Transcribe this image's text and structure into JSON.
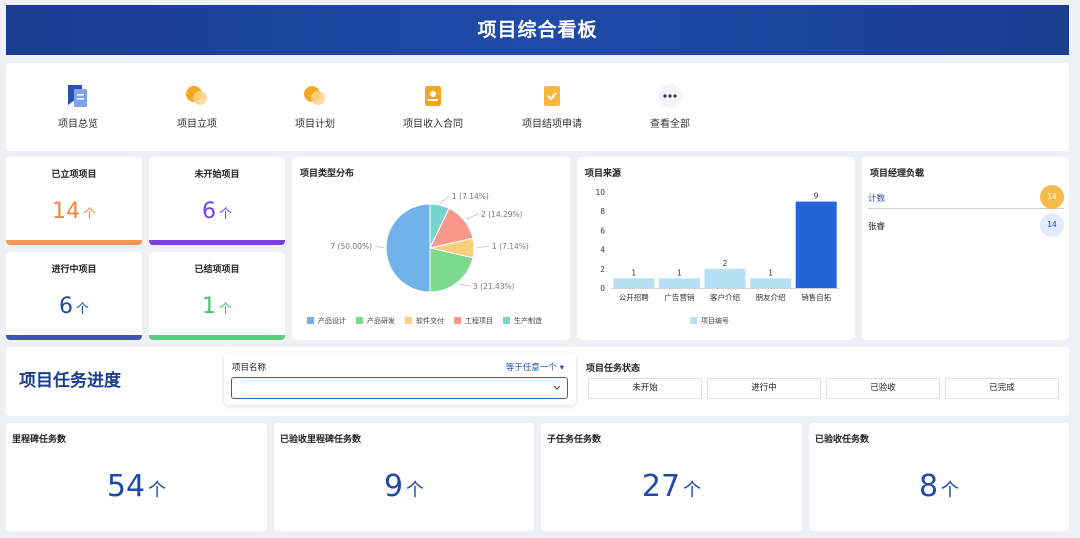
{
  "header": {
    "title": "项目综合看板"
  },
  "nav": {
    "items": [
      {
        "label": "项目总览",
        "icon": "bookmark-icon"
      },
      {
        "label": "项目立项",
        "icon": "circles-icon"
      },
      {
        "label": "项目计划",
        "icon": "circles-icon"
      },
      {
        "label": "项目收入合同",
        "icon": "contract-icon"
      },
      {
        "label": "项目结项申请",
        "icon": "check-document-icon"
      },
      {
        "label": "查看全部",
        "icon": "more-icon"
      }
    ]
  },
  "kpis": [
    {
      "title": "已立项项目",
      "value": "14",
      "unit": "个",
      "color": "#f0883a"
    },
    {
      "title": "未开始项目",
      "value": "6",
      "unit": "个",
      "color": "#7b3fe4"
    },
    {
      "title": "进行中项目",
      "value": "6",
      "unit": "个",
      "color": "#1f4aa8"
    },
    {
      "title": "已结项项目",
      "value": "1",
      "unit": "个",
      "color": "#3cc46a"
    }
  ],
  "pie": {
    "title": "项目类型分布",
    "chart_data": {
      "type": "pie",
      "slices": [
        {
          "name": "产品设计",
          "value": 7,
          "label": "7 (50.00%)",
          "color": "#6fb3ea"
        },
        {
          "name": "产品研发",
          "value": 3,
          "label": "3 (21.43%)",
          "color": "#7dd98f"
        },
        {
          "name": "软件交付",
          "value": 1,
          "label": "1 (7.14%)",
          "color": "#f9cf7b"
        },
        {
          "name": "工程项目",
          "value": 2,
          "label": "2 (14.29%)",
          "color": "#f5978a"
        },
        {
          "name": "生产制造",
          "value": 1,
          "label": "1 (7.14%)",
          "color": "#79d4cf"
        }
      ],
      "legend": "bottom"
    }
  },
  "bar": {
    "title": "项目来源",
    "chart_data": {
      "type": "bar",
      "categories": [
        "公开招聘",
        "广告营销",
        "客户介绍",
        "朋友介绍",
        "销售自拓"
      ],
      "values": [
        1,
        1,
        2,
        1,
        9
      ],
      "ylim": [
        0,
        10
      ],
      "yticks": [
        0,
        2,
        4,
        6,
        8,
        10
      ],
      "series_name": "项目编号",
      "colors": [
        "#b8e0f5",
        "#b8e0f5",
        "#b8e0f5",
        "#b8e0f5",
        "#2563d9"
      ],
      "legend": "bottom"
    }
  },
  "managers": {
    "title": "项目经理负载",
    "rows": [
      {
        "name": "计数",
        "value": "14",
        "badge_color": "#f5b94c",
        "text_color": "#1f4aa8"
      },
      {
        "name": "张睿",
        "value": "14",
        "badge_color": "#e3ecfb",
        "text_color": "#222"
      }
    ]
  },
  "tasks": {
    "title": "项目任务进度",
    "filter_label": "项目名称",
    "filter_mode": "等于任意一个",
    "filter_value": "",
    "status_title": "项目任务状态",
    "statuses": [
      "未开始",
      "进行中",
      "已验收",
      "已完成"
    ]
  },
  "stats": [
    {
      "title": "里程碑任务数",
      "value": "54",
      "unit": "个"
    },
    {
      "title": "已验收里程碑任务数",
      "value": "9",
      "unit": "个"
    },
    {
      "title": "子任务任务数",
      "value": "27",
      "unit": "个"
    },
    {
      "title": "已验收任务数",
      "value": "8",
      "unit": "个"
    }
  ]
}
